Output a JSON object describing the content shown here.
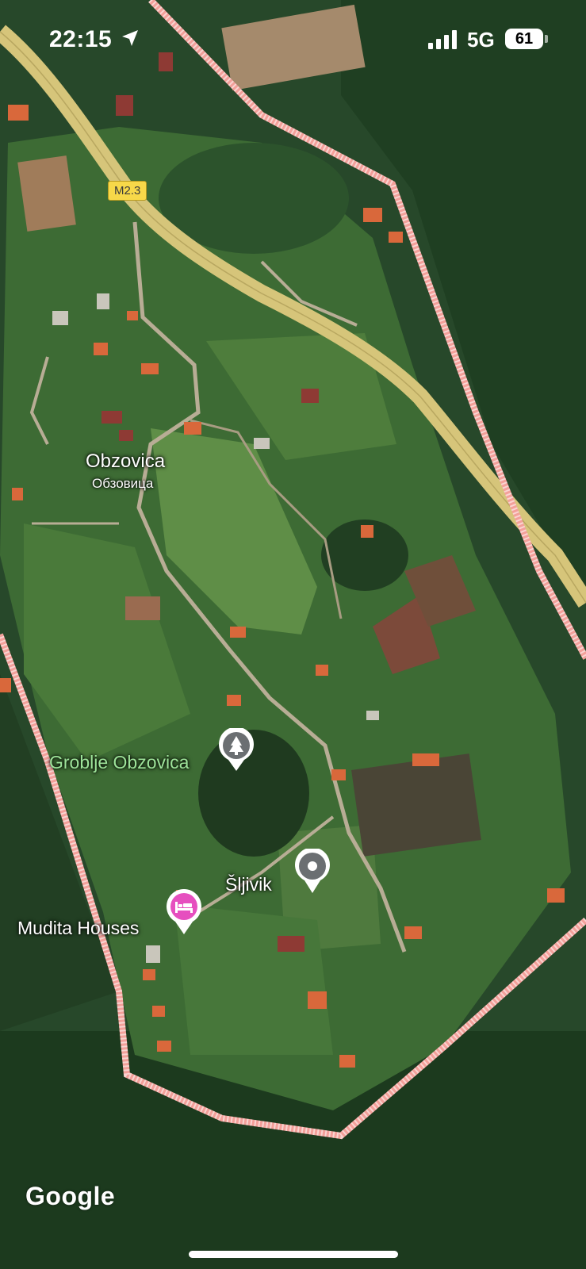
{
  "status_bar": {
    "time": "22:15",
    "network": "5G",
    "battery": "61"
  },
  "map": {
    "road_shield": "M2.3",
    "town_name": "Obzovica",
    "town_name_cyrillic": "Обзовица",
    "cemetery_label": "Groblje Obzovica",
    "place_label": "Šljivik",
    "hotel_label": "Mudita Houses",
    "attribution": "Google"
  },
  "colors": {
    "road": "#d6c57a",
    "boundary": "#f3a09a",
    "hotel_pin": "#e64fbf",
    "place_pin": "#6b6f72",
    "cemetery_label": "#9ee49a"
  },
  "icons": {
    "location": "location-arrow-icon",
    "signal": "cellular-signal-icon",
    "cemetery": "cemetery-icon",
    "place": "place-pin-icon",
    "hotel": "hotel-bed-icon"
  }
}
